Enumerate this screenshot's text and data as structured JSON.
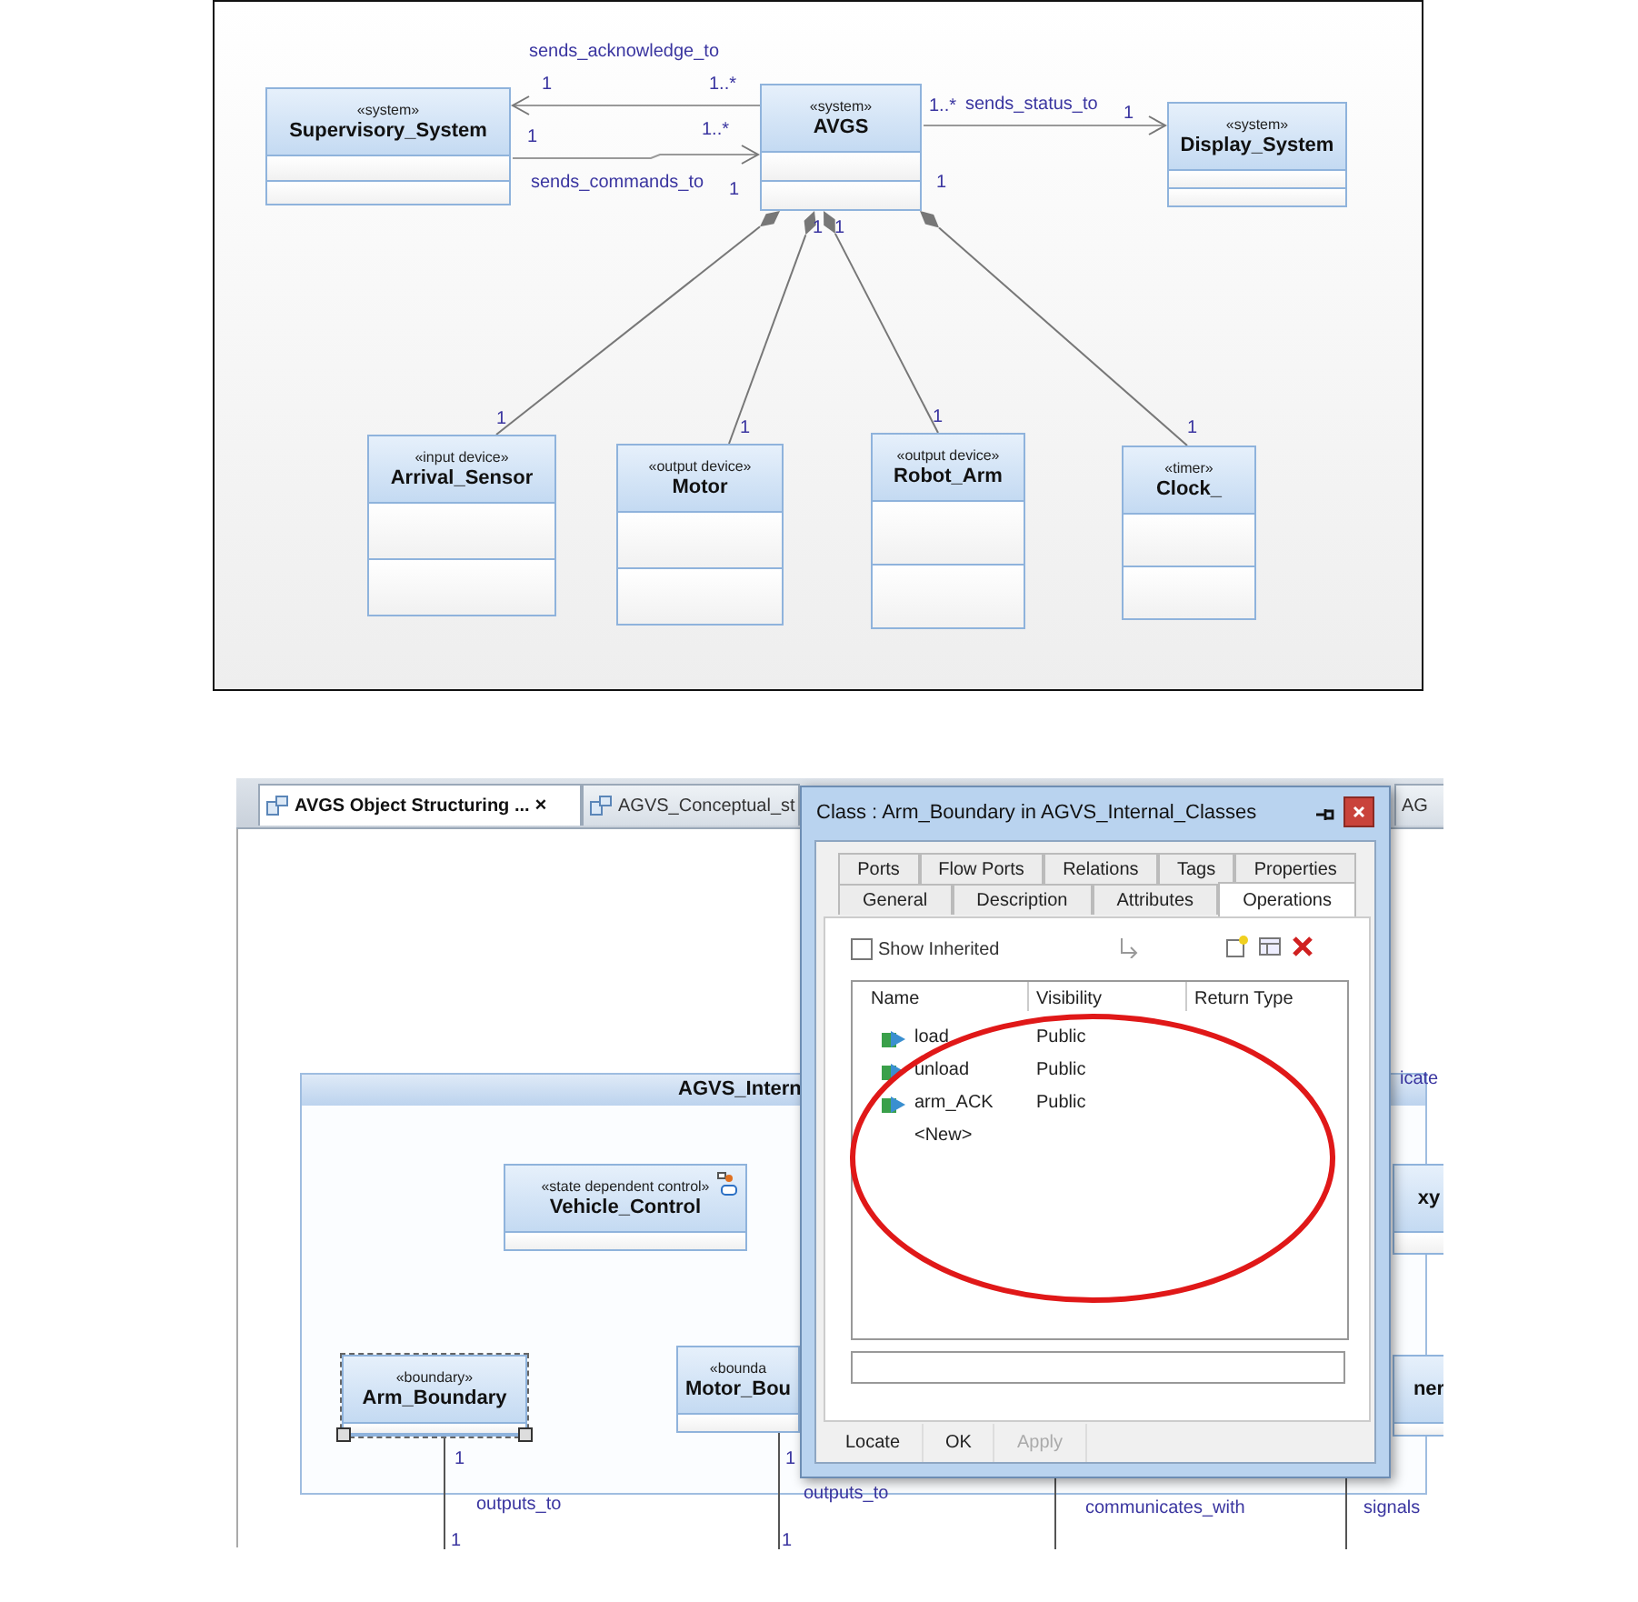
{
  "figure_1": {
    "classes": [
      {
        "stereotype": "«system»",
        "name": "Supervisory_System"
      },
      {
        "stereotype": "«system»",
        "name": "AVGS"
      },
      {
        "stereotype": "«system»",
        "name": "Display_System"
      },
      {
        "stereotype": "«input device»",
        "name": "Arrival_Sensor"
      },
      {
        "stereotype": "«output device»",
        "name": "Motor"
      },
      {
        "stereotype": "«output device»",
        "name": "Robot_Arm"
      },
      {
        "stereotype": "«timer»",
        "name": "Clock_"
      }
    ],
    "labels": [
      "sends_acknowledge_to",
      "1",
      "1..*",
      "1",
      "1..*",
      "sends_commands_to",
      "1",
      "1..*",
      "sends_status_to",
      "1",
      "1",
      "1",
      "1",
      "1",
      "1",
      "1",
      "1"
    ]
  },
  "figure_2": {
    "tabs": [
      {
        "label": "AVGS Object Structuring ...",
        "close": "×",
        "selected": true
      },
      {
        "label": "AGVS_Conceptual_st",
        "selected": false
      },
      {
        "label": "AG",
        "selected": false
      }
    ],
    "package_title": "AGVS_Intern",
    "classes": [
      {
        "stereotype": "«state dependent control»",
        "name": "Vehicle_Control",
        "selected": false
      },
      {
        "stereotype": "«boundary»",
        "name": "Arm_Boundary",
        "selected": true
      },
      {
        "stereotype": "«bounda",
        "name": "Motor_Bou",
        "selected": false
      },
      {
        "name": "xy",
        "selected": false
      },
      {
        "name": "ner",
        "selected": false
      }
    ],
    "labels": [
      "icate",
      "1",
      "outputs_to",
      "1",
      "1",
      "outputs_to",
      "1",
      "communicates_with",
      "signals"
    ],
    "dialog": {
      "title": "Class : Arm_Boundary in AGVS_Internal_Classes",
      "tab_rows": [
        [
          {
            "label": "Ports",
            "selected": false
          },
          {
            "label": "Flow Ports",
            "selected": false
          },
          {
            "label": "Relations",
            "selected": false
          },
          {
            "label": "Tags",
            "selected": false
          },
          {
            "label": "Properties",
            "selected": false
          }
        ],
        [
          {
            "label": "General",
            "selected": false
          },
          {
            "label": "Description",
            "selected": false
          },
          {
            "label": "Attributes",
            "selected": false
          },
          {
            "label": "Operations",
            "selected": true
          }
        ]
      ],
      "checkbox": {
        "label": "Show Inherited",
        "checked": false
      },
      "columns": [
        "Name",
        "Visibility",
        "Return Type"
      ],
      "rows": [
        {
          "name": "load",
          "visibility": "Public"
        },
        {
          "name": "unload",
          "visibility": "Public"
        },
        {
          "name": "arm_ACK",
          "visibility": "Public"
        }
      ],
      "new_row": "<New>",
      "buttons": [
        {
          "label": "Locate",
          "disabled": false
        },
        {
          "label": "OK",
          "disabled": false
        },
        {
          "label": "Apply",
          "disabled": true
        }
      ]
    }
  }
}
